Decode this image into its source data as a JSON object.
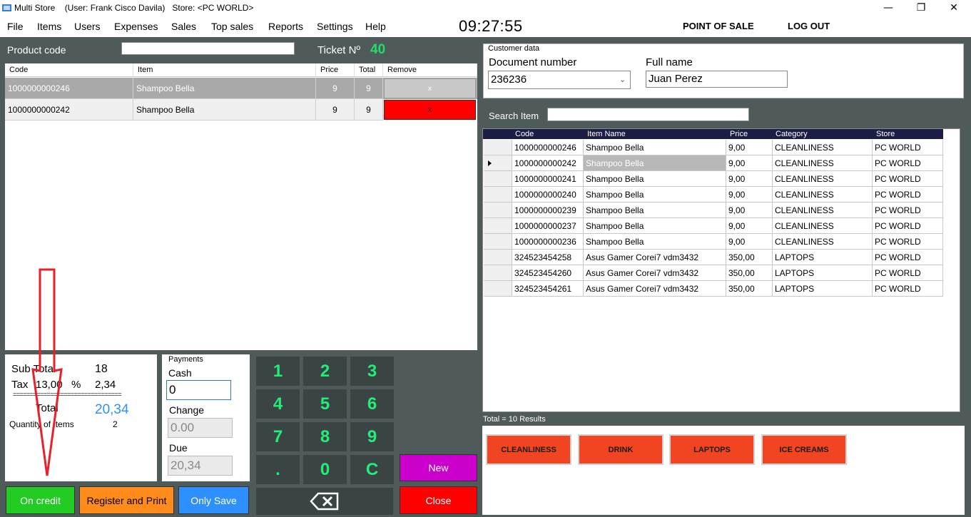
{
  "window": {
    "title": "Multi Store    (User: Frank Cisco Davila)   Store: <PC WORLD>",
    "minimize": "—",
    "maximize": "❐",
    "close": "✕"
  },
  "menu": [
    "File",
    "Items",
    "Users",
    "Expenses",
    "Sales",
    "Top sales",
    "Reports",
    "Settings",
    "Help"
  ],
  "clock": "09:27:55",
  "top_buttons": {
    "pos": "POINT OF SALE",
    "logout": "LOG OUT"
  },
  "product": {
    "label": "Product code",
    "value": ""
  },
  "ticket": {
    "label": "Ticket Nº",
    "number": "40"
  },
  "cart": {
    "headers": [
      "Code",
      "Item",
      "Price",
      "Total",
      "Remove"
    ],
    "rows": [
      {
        "code": "1000000000246",
        "item": "Shampoo Bella",
        "price": "9",
        "total": "9",
        "remove": "x"
      },
      {
        "code": "1000000000242",
        "item": "Shampoo Bella",
        "price": "9",
        "total": "9",
        "remove": "x"
      }
    ]
  },
  "totals": {
    "subtotal_label": "Sub Total",
    "subtotal": "18",
    "tax_label": "Tax",
    "tax_rate": "13,00",
    "tax_pct": "%",
    "tax_amount": "2,34",
    "separator": "================================",
    "total_label": "Total",
    "total": "20,34",
    "qty_label": "Quantity of Items",
    "qty": "2"
  },
  "payments": {
    "legend": "Payments",
    "cash_label": "Cash",
    "cash_value": "0",
    "change_label": "Change",
    "change_value": "0.00",
    "due_label": "Due",
    "due_value": "20,34"
  },
  "keypad": [
    "1",
    "2",
    "3",
    "4",
    "5",
    "6",
    "7",
    "8",
    "9",
    ".",
    "0",
    "C"
  ],
  "actions": {
    "new": "New",
    "close": "Close",
    "on_credit": "On credit",
    "register_print": "Register and Print",
    "only_save": "Only Save"
  },
  "customer": {
    "legend": "Customer data",
    "doc_label": "Document number",
    "doc_value": "236236",
    "name_label": "Full name",
    "name_value": "Juan Perez"
  },
  "search": {
    "label": "Search Item",
    "value": ""
  },
  "items": {
    "headers": [
      "Code",
      "Item Name",
      "Price",
      "Category",
      "Store"
    ],
    "rows": [
      {
        "code": "1000000000246",
        "name": "Shampoo Bella",
        "price": "9,00",
        "category": "CLEANLINESS",
        "store": "PC WORLD"
      },
      {
        "code": "1000000000242",
        "name": "Shampoo Bella",
        "price": "9,00",
        "category": "CLEANLINESS",
        "store": "PC WORLD"
      },
      {
        "code": "1000000000241",
        "name": "Shampoo Bella",
        "price": "9,00",
        "category": "CLEANLINESS",
        "store": "PC WORLD"
      },
      {
        "code": "1000000000240",
        "name": "Shampoo Bella",
        "price": "9,00",
        "category": "CLEANLINESS",
        "store": "PC WORLD"
      },
      {
        "code": "1000000000239",
        "name": "Shampoo Bella",
        "price": "9,00",
        "category": "CLEANLINESS",
        "store": "PC WORLD"
      },
      {
        "code": "1000000000237",
        "name": "Shampoo Bella",
        "price": "9,00",
        "category": "CLEANLINESS",
        "store": "PC WORLD"
      },
      {
        "code": "1000000000236",
        "name": "Shampoo Bella",
        "price": "9,00",
        "category": "CLEANLINESS",
        "store": "PC WORLD"
      },
      {
        "code": "324523454258",
        "name": "Asus Gamer Corei7 vdm3432",
        "price": "350,00",
        "category": "LAPTOPS",
        "store": "PC WORLD"
      },
      {
        "code": "324523454260",
        "name": "Asus Gamer Corei7 vdm3432",
        "price": "350,00",
        "category": "LAPTOPS",
        "store": "PC WORLD"
      },
      {
        "code": "324523454261",
        "name": "Asus Gamer Corei7 vdm3432",
        "price": "350,00",
        "category": "LAPTOPS",
        "store": "PC WORLD"
      }
    ],
    "results": "Total = 10 Results"
  },
  "categories": [
    "CLEANLINESS",
    "DRINK",
    "LAPTOPS",
    "ICE CREAMS"
  ],
  "colors": {
    "background": "#4f5b5b",
    "keypad_bg": "#3b4444",
    "keypad_digit": "#22ee77",
    "remove_red": "#ff0000",
    "new_purple": "#cc00cc",
    "close_red": "#ff0000",
    "credit_green": "#22cc22",
    "register_orange": "#ff8c1a",
    "save_blue": "#2e8fff",
    "category_orange": "#f04520",
    "annotation_arrow": "#e8202a"
  }
}
